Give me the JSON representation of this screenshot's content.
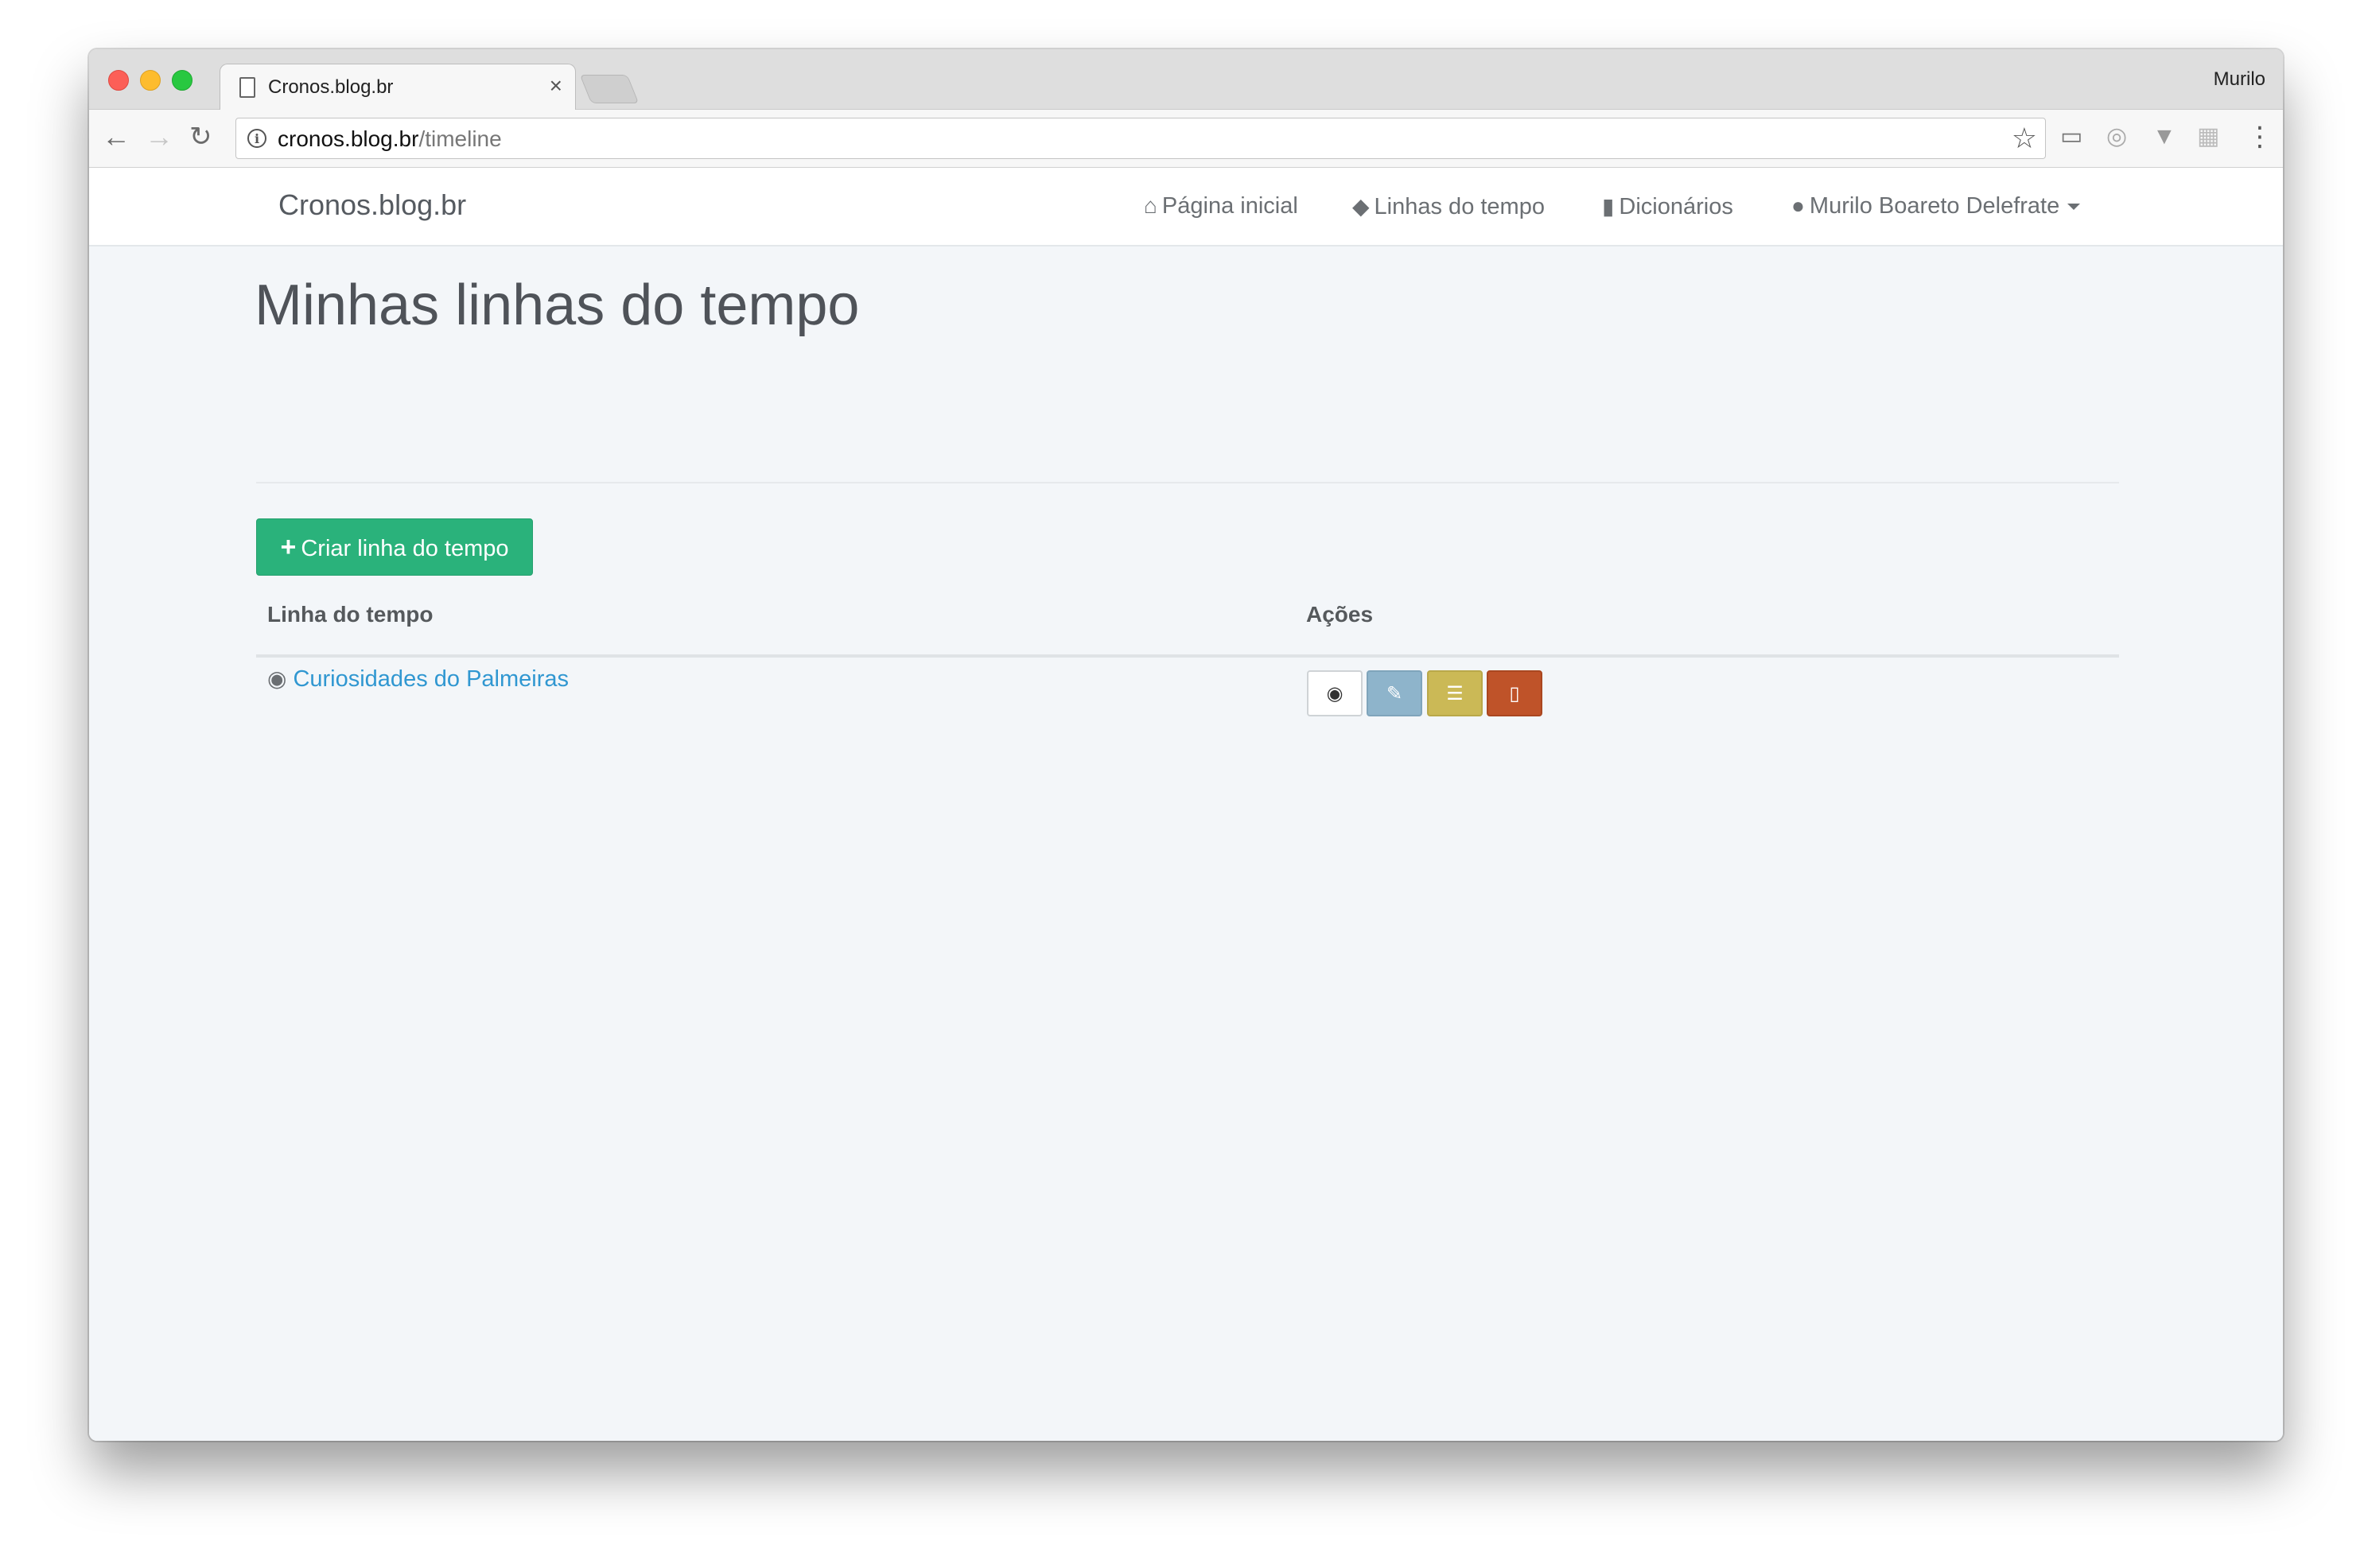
{
  "browser": {
    "tab_title": "Cronos.blog.br",
    "tab_close": "×",
    "profile_name": "Murilo",
    "url_host": "cronos.blog.br",
    "url_path": "/timeline"
  },
  "site": {
    "brand": "Cronos.blog.br",
    "nav": {
      "home": "Página inicial",
      "timelines": "Linhas do tempo",
      "dictionaries": "Dicionários",
      "user": "Murilo Boareto Delefrate"
    }
  },
  "main": {
    "title": "Minhas linhas do tempo",
    "create_button": "Criar linha do tempo",
    "table": {
      "columns": [
        "Linha do tempo",
        "Ações"
      ],
      "rows": [
        {
          "name": "Curiosidades do Palmeiras"
        }
      ]
    }
  },
  "icons": {
    "home": "home-icon",
    "timelines": "graduation-cap-icon",
    "dictionaries": "book-icon",
    "user": "user-icon",
    "row_public": "globe-icon",
    "view": "eye-icon",
    "edit": "edit-icon",
    "page": "list-icon",
    "delete": "trash-icon"
  },
  "colors": {
    "success": "#2ab27b",
    "link": "#3097d1",
    "info": "#8eb4cb",
    "warning": "#cbb956",
    "danger": "#bf5329"
  }
}
